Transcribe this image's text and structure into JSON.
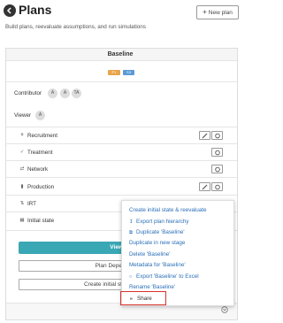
{
  "header": {
    "title": "Plans",
    "subtitle": "Build plans, reevaluate assumptions, and run simulations",
    "new_plan_label": "New plan"
  },
  "card": {
    "title": "Baseline",
    "badges": [
      "P1",
      "S3"
    ],
    "contributor_label": "Contributor",
    "contributors": [
      "A",
      "A",
      "TA"
    ],
    "viewer_label": "Viewer",
    "viewers": [
      "A"
    ],
    "rows": [
      {
        "label": "Recruitment",
        "icon": "people-icon"
      },
      {
        "label": "Treatment",
        "icon": "syringe-icon"
      },
      {
        "label": "Network",
        "icon": "network-icon"
      },
      {
        "label": "Production",
        "icon": "bar-chart-icon"
      },
      {
        "label": "IRT",
        "icon": "shuffle-icon"
      },
      {
        "label": "Initial state",
        "icon": "building-icon"
      }
    ],
    "view_button": "View",
    "plan_deps_button": "Plan Depe",
    "create_initial_button": "Create initial st"
  },
  "menu": {
    "items": [
      "Create initial state & reevaluate",
      "Export plan hierarchy",
      "Duplicate 'Baseline'",
      "Duplicate in new stage",
      "Delete 'Baseline'",
      "Metadata for 'Baseline'",
      "Export 'Baseline' to Excel",
      "Rename 'Baseline'"
    ],
    "share_label": "Share"
  },
  "colors": {
    "accent": "#3aa7b5",
    "link": "#2a6fb8",
    "highlight": "#d9312c"
  }
}
